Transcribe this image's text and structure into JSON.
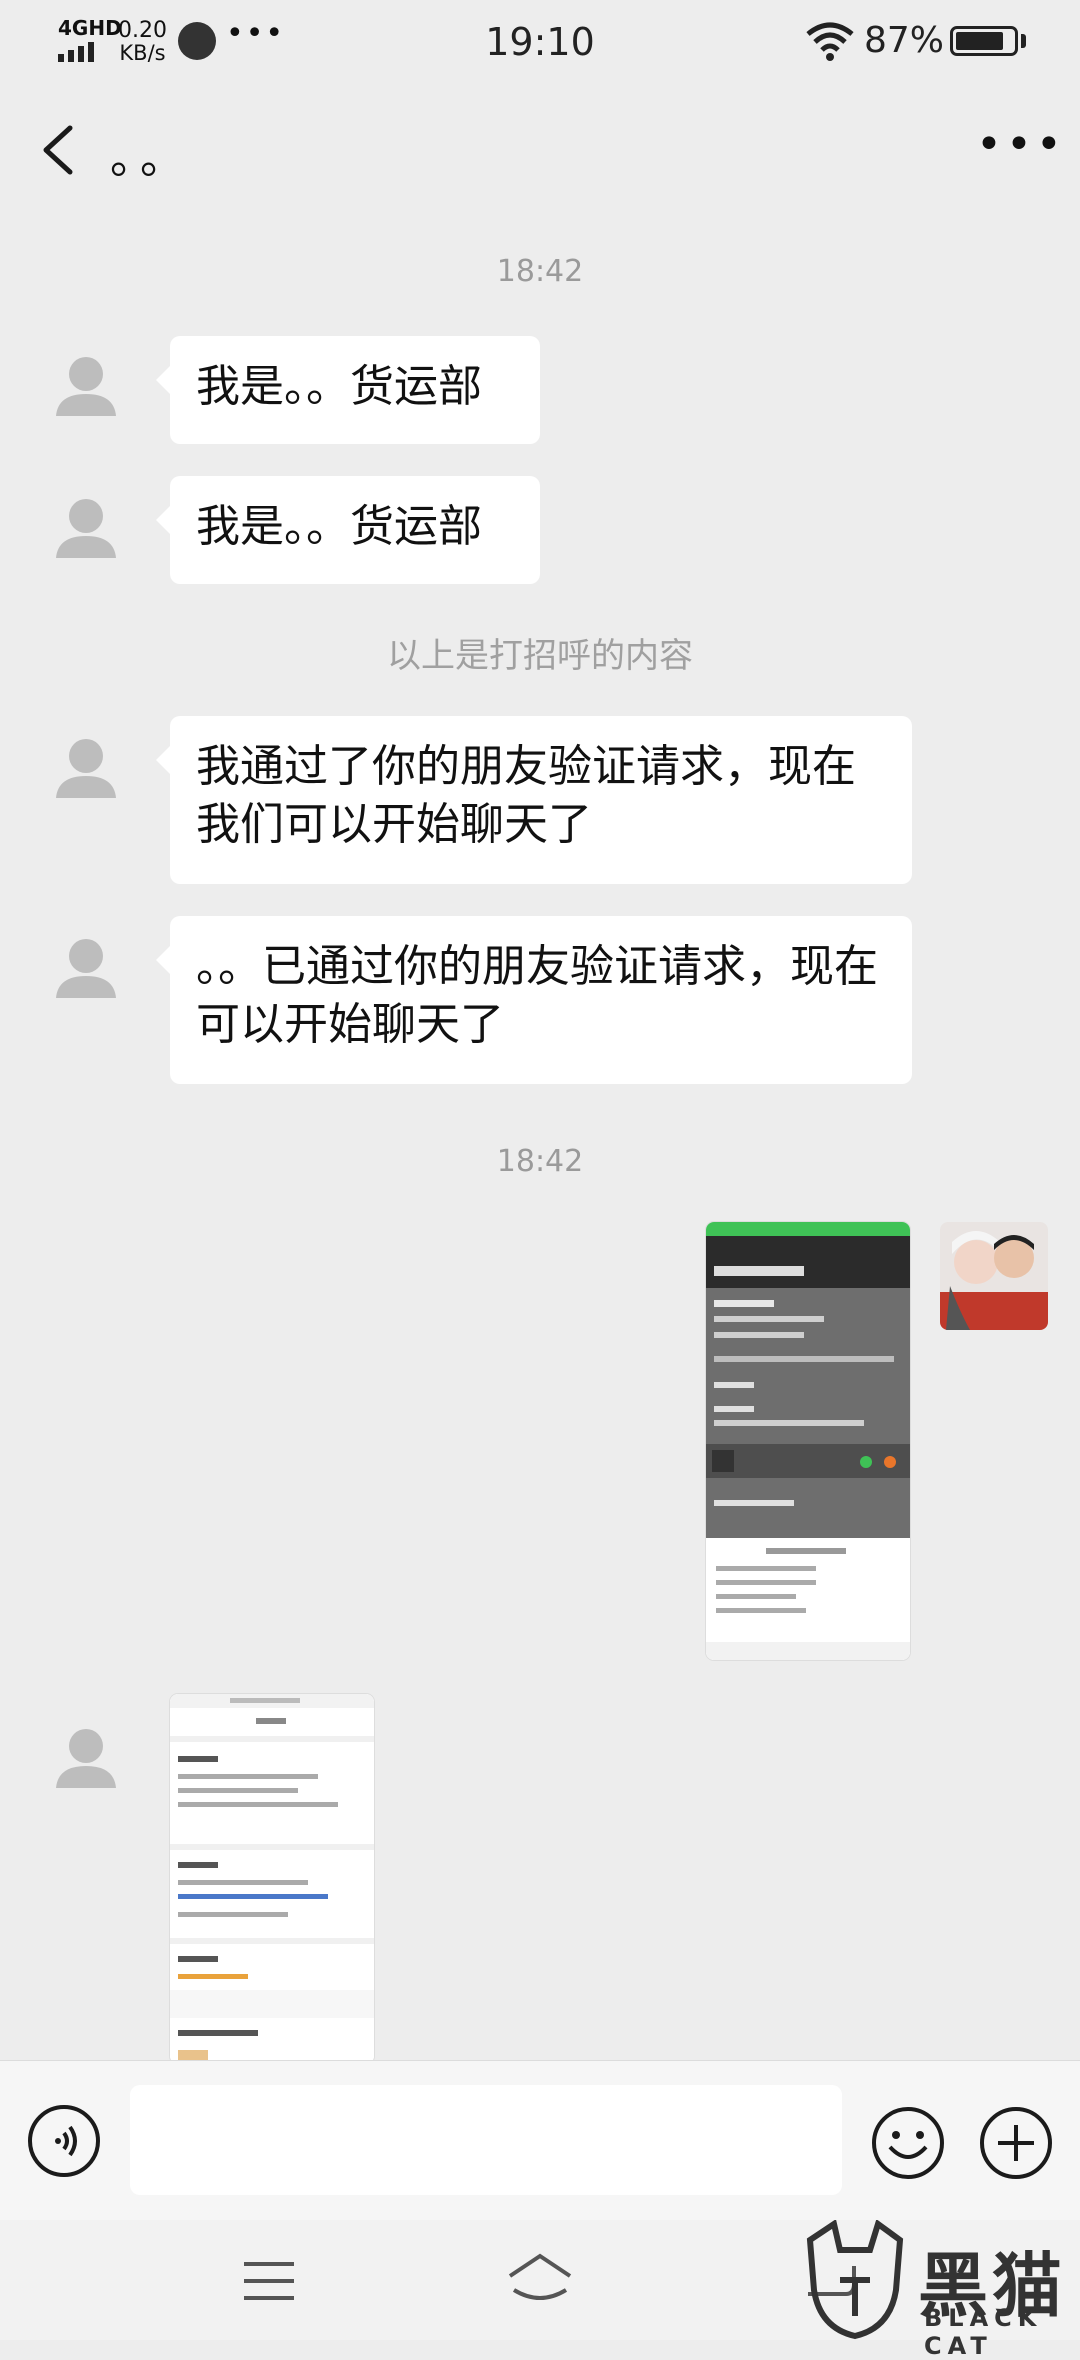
{
  "status_bar": {
    "network": "4GHD",
    "speed_value": "0.20",
    "speed_unit": "KB/s",
    "dots": "•••",
    "time": "19:10",
    "battery": "87%"
  },
  "header": {
    "title": "。。",
    "more": "•••"
  },
  "chat": {
    "timestamps": [
      "18:42",
      "18:42"
    ],
    "messages": [
      {
        "text": "我是。。货运部"
      },
      {
        "text": "我是。。货运部"
      },
      {
        "text": "我通过了你的朋友验证请求，现在我们可以开始聊天了"
      },
      {
        "text": "。。已通过你的朋友验证请求，现在可以开始聊天了"
      }
    ],
    "system_note": "以上是打招呼的内容"
  },
  "watermark": {
    "cn": "黑猫",
    "en": "BLACK CAT"
  },
  "colors": {
    "background": "#ededed",
    "bubble": "#ffffff",
    "accent_green": "#3fc256"
  }
}
